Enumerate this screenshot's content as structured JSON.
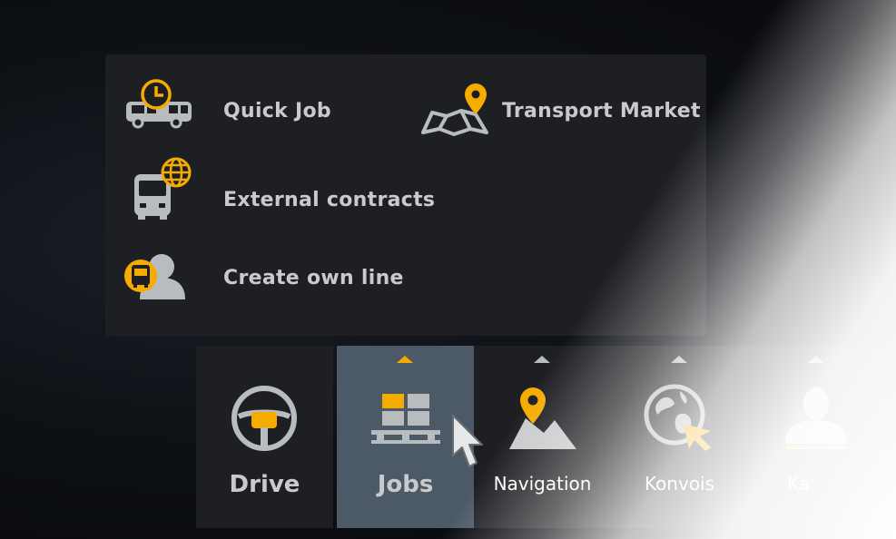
{
  "submenu": {
    "items": [
      {
        "label": "Quick Job",
        "icon": "bus-clock-icon"
      },
      {
        "label": "Transport Market",
        "icon": "map-pin-icon"
      },
      {
        "label": "External contracts",
        "icon": "bus-globe-icon"
      },
      {
        "label": "Create own line",
        "icon": "bus-person-icon"
      }
    ]
  },
  "tabs": [
    {
      "label": "Drive",
      "icon": "steering-wheel-icon",
      "selected": false
    },
    {
      "label": "Jobs",
      "icon": "pallet-boxes-icon",
      "selected": true
    },
    {
      "label": "Navigation",
      "icon": "map-pin-icon",
      "selected": false
    },
    {
      "label": "Konvois",
      "icon": "globe-cursor-icon",
      "selected": false
    },
    {
      "label": "Ka",
      "icon": "person-icon",
      "selected": false
    }
  ],
  "colors": {
    "accent": "#f6ab00",
    "panel": "#1d1f22",
    "selected_tab": "#4b5a66",
    "text": "#c8cacc",
    "icon_gray": "#b9bcbf"
  }
}
